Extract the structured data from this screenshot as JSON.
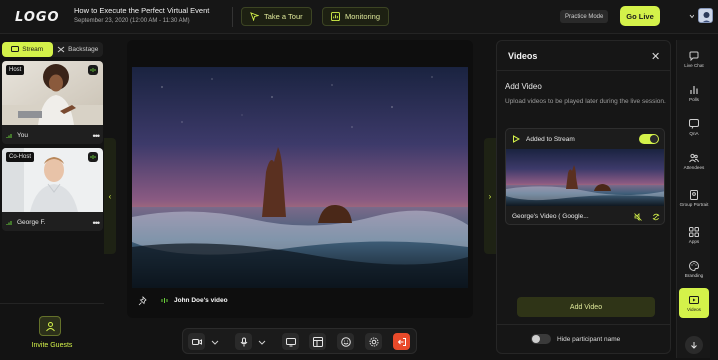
{
  "header": {
    "logo": "LOGO",
    "event_title": "How to Execute the Perfect Virtual Event",
    "event_date": "September 23, 2020 (12:00 AM - 11:30 AM)",
    "take_tour": "Take a Tour",
    "monitoring": "Monitoring",
    "practice_mode": "Practice Mode",
    "go_live": "Go Live"
  },
  "left": {
    "stream_tab": "Stream",
    "backstage_tab": "Backstage",
    "participants": [
      {
        "role": "Host",
        "name": "You"
      },
      {
        "role": "Co-Host",
        "name": "George F."
      }
    ],
    "invite_label": "Invite Guests"
  },
  "stage": {
    "video_label": "John Doe's video"
  },
  "videos_panel": {
    "title": "Videos",
    "add_heading": "Add Video",
    "add_description": "Upload videos to be played later during the live session.",
    "card_status": "Added to Stream",
    "card_name": "George's Video ( Google...",
    "add_button": "Add Video",
    "hide_label": "Hide participant name"
  },
  "right_nav": {
    "items": [
      {
        "label": "Live Chat",
        "icon": "chat-icon"
      },
      {
        "label": "Polls",
        "icon": "polls-icon"
      },
      {
        "label": "QnA",
        "icon": "qna-icon"
      },
      {
        "label": "Attendees",
        "icon": "attendees-icon"
      },
      {
        "label": "Group Portrait",
        "icon": "group-portrait-icon"
      },
      {
        "label": "Apps",
        "icon": "apps-icon"
      },
      {
        "label": "Branding",
        "icon": "branding-icon"
      },
      {
        "label": "Videos",
        "icon": "videos-icon"
      }
    ]
  },
  "colors": {
    "accent": "#d4f24a",
    "background": "#131313",
    "leave": "#e94a2a"
  }
}
